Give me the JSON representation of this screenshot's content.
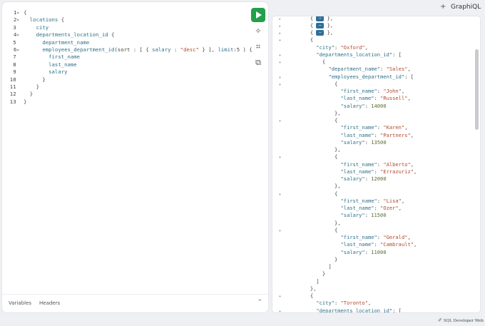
{
  "topbar": {
    "plus": "+",
    "title": "GraphiQL"
  },
  "editor": {
    "lines": [
      {
        "n": "1",
        "fold": "▾",
        "parts": [
          [
            "punc",
            "{"
          ]
        ]
      },
      {
        "n": "2",
        "fold": "▾",
        "parts": [
          [
            "k",
            "  locations "
          ],
          [
            "punc",
            "{"
          ]
        ]
      },
      {
        "n": "3",
        "fold": "",
        "parts": [
          [
            "k",
            "    city"
          ]
        ]
      },
      {
        "n": "4",
        "fold": "▾",
        "parts": [
          [
            "k",
            "    departments_location_id "
          ],
          [
            "punc",
            "{"
          ]
        ]
      },
      {
        "n": "5",
        "fold": "",
        "parts": [
          [
            "k",
            "      department_name"
          ]
        ]
      },
      {
        "n": "6",
        "fold": "▾",
        "parts": [
          [
            "k",
            "      employees_department_id"
          ],
          [
            "punc",
            "(sort : [ { "
          ],
          [
            "k",
            "salary"
          ],
          [
            "punc",
            " : "
          ],
          [
            "str",
            "\"desc\""
          ],
          [
            "punc",
            " } ], "
          ],
          [
            "k",
            "limit"
          ],
          [
            "punc",
            ":5 ) {"
          ]
        ]
      },
      {
        "n": "7",
        "fold": "",
        "parts": [
          [
            "k",
            "        first_name"
          ]
        ]
      },
      {
        "n": "8",
        "fold": "",
        "parts": [
          [
            "k",
            "        last_name"
          ]
        ]
      },
      {
        "n": "9",
        "fold": "",
        "parts": [
          [
            "k",
            "        salary"
          ]
        ]
      },
      {
        "n": "10",
        "fold": "",
        "parts": [
          [
            "punc",
            "      }"
          ]
        ]
      },
      {
        "n": "11",
        "fold": "",
        "parts": [
          [
            "punc",
            "    }"
          ]
        ]
      },
      {
        "n": "12",
        "fold": "",
        "parts": [
          [
            "punc",
            "  }"
          ]
        ]
      },
      {
        "n": "13",
        "fold": "",
        "parts": [
          [
            "punc",
            "}"
          ]
        ]
      }
    ]
  },
  "tools": {
    "run": "run-query",
    "prettify": "prettify-icon",
    "merge": "merge-fragments-icon",
    "copy": "copy-icon"
  },
  "bottom": {
    "variables": "Variables",
    "headers": "Headers",
    "chevron": "⌃"
  },
  "result": {
    "lines": [
      {
        "fold": "▸",
        "ind": 3,
        "html": "{ <pill/> },",
        "pill": "⋯"
      },
      {
        "fold": "▸",
        "ind": 3,
        "html": "{ <pill/> },",
        "pill": "⋯"
      },
      {
        "fold": "▸",
        "ind": 3,
        "html": "{ <pill/> },",
        "pill": "⋯"
      },
      {
        "fold": "▾",
        "ind": 3,
        "html": "{"
      },
      {
        "fold": "",
        "ind": 5,
        "key": "\"city\"",
        "sep": ": ",
        "str": "\"Oxford\"",
        "end": ","
      },
      {
        "fold": "▾",
        "ind": 5,
        "key": "\"departments_location_id\"",
        "sep": ": ["
      },
      {
        "fold": "▾",
        "ind": 7,
        "html": "{"
      },
      {
        "fold": "",
        "ind": 9,
        "key": "\"department_name\"",
        "sep": ": ",
        "str": "\"Sales\"",
        "end": ","
      },
      {
        "fold": "▾",
        "ind": 9,
        "key": "\"employees_department_id\"",
        "sep": ": ["
      },
      {
        "fold": "▾",
        "ind": 11,
        "html": "{"
      },
      {
        "fold": "",
        "ind": 13,
        "key": "\"first_name\"",
        "sep": ": ",
        "str": "\"John\"",
        "end": ","
      },
      {
        "fold": "",
        "ind": 13,
        "key": "\"last_name\"",
        "sep": ": ",
        "str": "\"Russell\"",
        "end": ","
      },
      {
        "fold": "",
        "ind": 13,
        "key": "\"salary\"",
        "sep": ": ",
        "num": "14000"
      },
      {
        "fold": "",
        "ind": 11,
        "html": "},"
      },
      {
        "fold": "▾",
        "ind": 11,
        "html": "{"
      },
      {
        "fold": "",
        "ind": 13,
        "key": "\"first_name\"",
        "sep": ": ",
        "str": "\"Karen\"",
        "end": ","
      },
      {
        "fold": "",
        "ind": 13,
        "key": "\"last_name\"",
        "sep": ": ",
        "str": "\"Partners\"",
        "end": ","
      },
      {
        "fold": "",
        "ind": 13,
        "key": "\"salary\"",
        "sep": ": ",
        "num": "13500"
      },
      {
        "fold": "",
        "ind": 11,
        "html": "},"
      },
      {
        "fold": "▾",
        "ind": 11,
        "html": "{"
      },
      {
        "fold": "",
        "ind": 13,
        "key": "\"first_name\"",
        "sep": ": ",
        "str": "\"Alberto\"",
        "end": ","
      },
      {
        "fold": "",
        "ind": 13,
        "key": "\"last_name\"",
        "sep": ": ",
        "str": "\"Errazuriz\"",
        "end": ","
      },
      {
        "fold": "",
        "ind": 13,
        "key": "\"salary\"",
        "sep": ": ",
        "num": "12000"
      },
      {
        "fold": "",
        "ind": 11,
        "html": "},"
      },
      {
        "fold": "▾",
        "ind": 11,
        "html": "{"
      },
      {
        "fold": "",
        "ind": 13,
        "key": "\"first_name\"",
        "sep": ": ",
        "str": "\"Lisa\"",
        "end": ","
      },
      {
        "fold": "",
        "ind": 13,
        "key": "\"last_name\"",
        "sep": ": ",
        "str": "\"Ozer\"",
        "end": ","
      },
      {
        "fold": "",
        "ind": 13,
        "key": "\"salary\"",
        "sep": ": ",
        "num": "11500"
      },
      {
        "fold": "",
        "ind": 11,
        "html": "},"
      },
      {
        "fold": "▾",
        "ind": 11,
        "html": "{"
      },
      {
        "fold": "",
        "ind": 13,
        "key": "\"first_name\"",
        "sep": ": ",
        "str": "\"Gerald\"",
        "end": ","
      },
      {
        "fold": "",
        "ind": 13,
        "key": "\"last_name\"",
        "sep": ": ",
        "str": "\"Cambrault\"",
        "end": ","
      },
      {
        "fold": "",
        "ind": 13,
        "key": "\"salary\"",
        "sep": ": ",
        "num": "11000"
      },
      {
        "fold": "",
        "ind": 11,
        "html": "}"
      },
      {
        "fold": "",
        "ind": 9,
        "html": "]"
      },
      {
        "fold": "",
        "ind": 7,
        "html": "}"
      },
      {
        "fold": "",
        "ind": 5,
        "html": "]"
      },
      {
        "fold": "",
        "ind": 3,
        "html": "},"
      },
      {
        "fold": "▾",
        "ind": 3,
        "html": "{"
      },
      {
        "fold": "",
        "ind": 5,
        "key": "\"city\"",
        "sep": ": ",
        "str": "\"Toronto\"",
        "end": ","
      },
      {
        "fold": "▾",
        "ind": 5,
        "key": "\"departments_location_id\"",
        "sep": ": ["
      }
    ]
  },
  "footer": {
    "icon": "✐",
    "text": "SQL Developer Web"
  }
}
